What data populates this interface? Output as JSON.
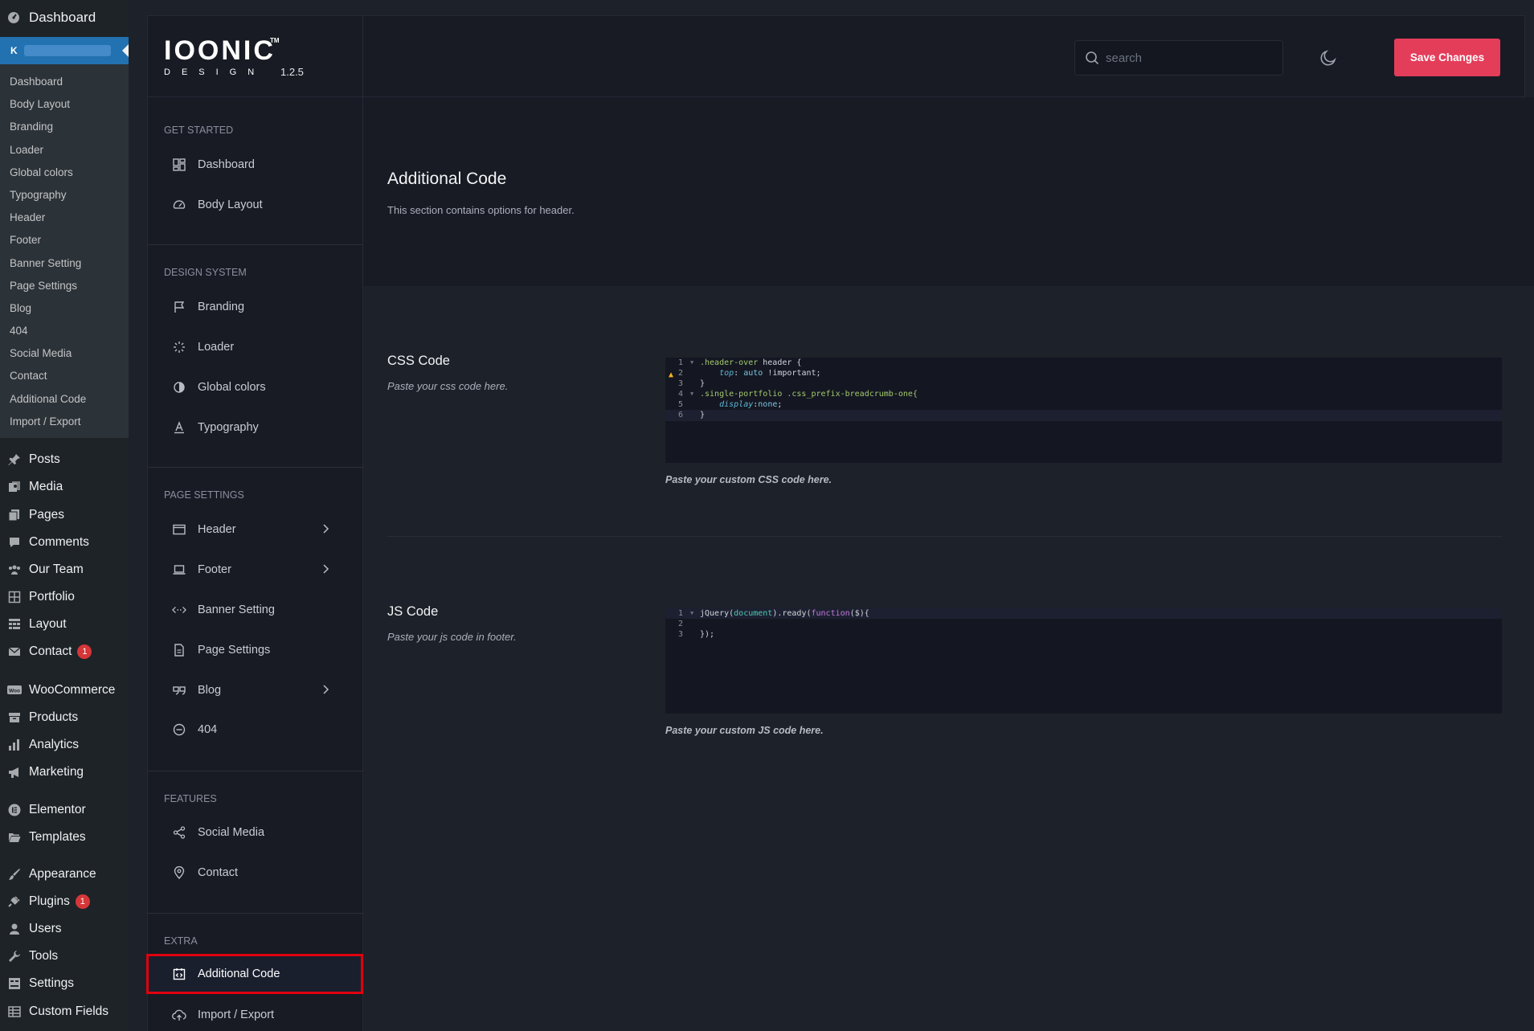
{
  "wp_sidebar": {
    "top_item": "Dashboard",
    "current_badge": "K",
    "submenu": [
      "Dashboard",
      "Body Layout",
      "Branding",
      "Loader",
      "Global colors",
      "Typography",
      "Header",
      "Footer",
      "Banner Setting",
      "Page Settings",
      "Blog",
      "404",
      "Social Media",
      "Contact",
      "Additional Code",
      "Import / Export"
    ],
    "menu": {
      "posts": "Posts",
      "media": "Media",
      "pages": "Pages",
      "comments": "Comments",
      "our_team": "Our Team",
      "portfolio": "Portfolio",
      "layout": "Layout",
      "contact": "Contact",
      "contact_badge": "1",
      "woocommerce": "WooCommerce",
      "products": "Products",
      "analytics": "Analytics",
      "marketing": "Marketing",
      "elementor": "Elementor",
      "templates": "Templates",
      "appearance": "Appearance",
      "plugins": "Plugins",
      "plugins_badge": "1",
      "users": "Users",
      "tools": "Tools",
      "settings": "Settings",
      "custom_fields": "Custom Fields"
    }
  },
  "brand": {
    "logo": "IOONIC",
    "tm": "TM",
    "design": "DESIGN",
    "version": "1.2.5"
  },
  "topbar": {
    "search_placeholder": "search",
    "save_label": "Save Changes"
  },
  "nav": {
    "get_started": {
      "title": "GET STARTED",
      "items": [
        "Dashboard",
        "Body Layout"
      ]
    },
    "design_system": {
      "title": "DESIGN SYSTEM",
      "items": [
        "Branding",
        "Loader",
        "Global colors",
        "Typography"
      ]
    },
    "page_settings": {
      "title": "PAGE SETTINGS",
      "items": [
        "Header",
        "Footer",
        "Banner Setting",
        "Page Settings",
        "Blog",
        "404"
      ]
    },
    "features": {
      "title": "FEATURES",
      "items": [
        "Social Media",
        "Contact"
      ]
    },
    "extra": {
      "title": "EXTRA",
      "items": [
        "Additional Code",
        "Import / Export"
      ]
    }
  },
  "content": {
    "title": "Additional Code",
    "description": "This section contains options for header.",
    "css": {
      "title": "CSS Code",
      "subtitle": "Paste your css code here.",
      "hint": "Paste your custom CSS code here.",
      "line_numbers": [
        "1",
        "2",
        "3",
        "4",
        "5",
        "6"
      ],
      "lines": {
        "l1_sel": ".header-over",
        "l1_rest": " header {",
        "l2_prop": "top",
        "l2_colon": ": ",
        "l2_val": "auto",
        "l2_imp": " !important;",
        "l3": "}",
        "l4_sel": ".single-portfolio .css_prefix-breadcrumb-one{",
        "l5_prop": "display",
        "l5_colon": ":",
        "l5_val": "none",
        "l5_semi": ";",
        "l6": "}"
      }
    },
    "js": {
      "title": "JS Code",
      "subtitle": "Paste your js code in footer.",
      "hint": "Paste your custom JS code here.",
      "line_numbers": [
        "1",
        "2",
        "3"
      ],
      "lines": {
        "l1_a": "jQuery(",
        "l1_doc": "document",
        "l1_b": ").ready(",
        "l1_fn": "function",
        "l1_c": "($){",
        "l3": "});"
      }
    }
  }
}
